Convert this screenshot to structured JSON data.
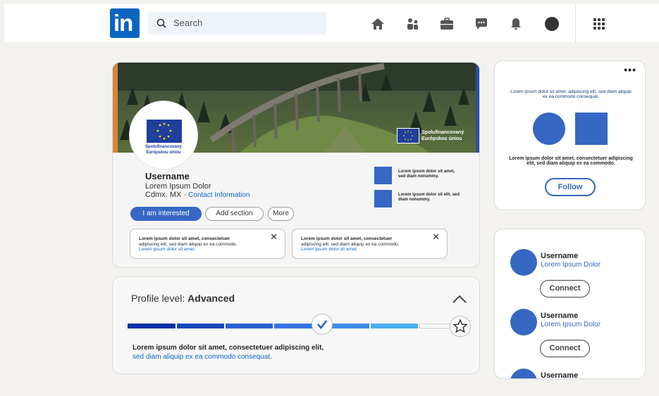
{
  "header": {
    "logo_text": "in",
    "search_placeholder": "Search",
    "icons": [
      "home-icon",
      "network-icon",
      "jobs-icon",
      "messaging-icon",
      "notifications-icon",
      "me-avatar",
      "apps-grid-icon"
    ]
  },
  "profile": {
    "banner_badge": [
      "Spolufinancovaný",
      "Európskou úniou"
    ],
    "avatar_caption": [
      "Spolufinancovaný",
      "Európskou úniou"
    ],
    "username": "Username",
    "headline": "Lorem Ipsum Dolor",
    "location": "Cdmx. MX ·",
    "contact_link": "Contact Information",
    "buttons": {
      "interested": "I am interested",
      "add_section": "Add section",
      "more": "More"
    },
    "side_items": [
      {
        "text": "Lorem ipsum dolor sit amet, sed diam nonummy."
      },
      {
        "text": "Lorem ipsum dolor sit elit, sed diam nonummy."
      }
    ],
    "notes": [
      {
        "line1": "Lorem ipsum dolor sit amet, consectetuer",
        "line2": "adipiscing elit, sed diam aliquip ex ea commodo.",
        "line3": "Lorem ipsum dolor sit amet."
      },
      {
        "line1": "Lorem ipsum dolor sit amet, consectetuer",
        "line2": "adipiscing elit, sed diam aliquip ex ea commodo.",
        "line3": "Lorem ipsum dolor sit amet."
      }
    ]
  },
  "level": {
    "title_prefix": "Profile level: ",
    "title_value": "Advanced",
    "progress_steps_completed": 4,
    "progress_steps_total": 7,
    "desc_line1": "Lorem ipsum dolor sit amet, consectetuer adipiscing elit,",
    "desc_line2": "sed diam aliquip ex ea commodo consequat."
  },
  "promo": {
    "text_top": "Lorem ipsum dolor sit amet, adipiscing elit, sed diam aliquip ex ea commodo consequat.",
    "text_bottom": "Lorem ipsum dolor sit amet, consectetuer adipiscing elit, sed diam aliquip ex ea commodo.",
    "follow_label": "Follow"
  },
  "suggestions": [
    {
      "name": "Username",
      "subtitle": "Lorem Ipsum Dolor",
      "button": "Connect"
    },
    {
      "name": "Username",
      "subtitle": "Lorem Ipsum Dolor",
      "button": "Connect"
    },
    {
      "name": "Username"
    }
  ],
  "colors": {
    "brand": "#0a66c2",
    "accent": "#3667c3",
    "background": "#f3f2ef"
  }
}
